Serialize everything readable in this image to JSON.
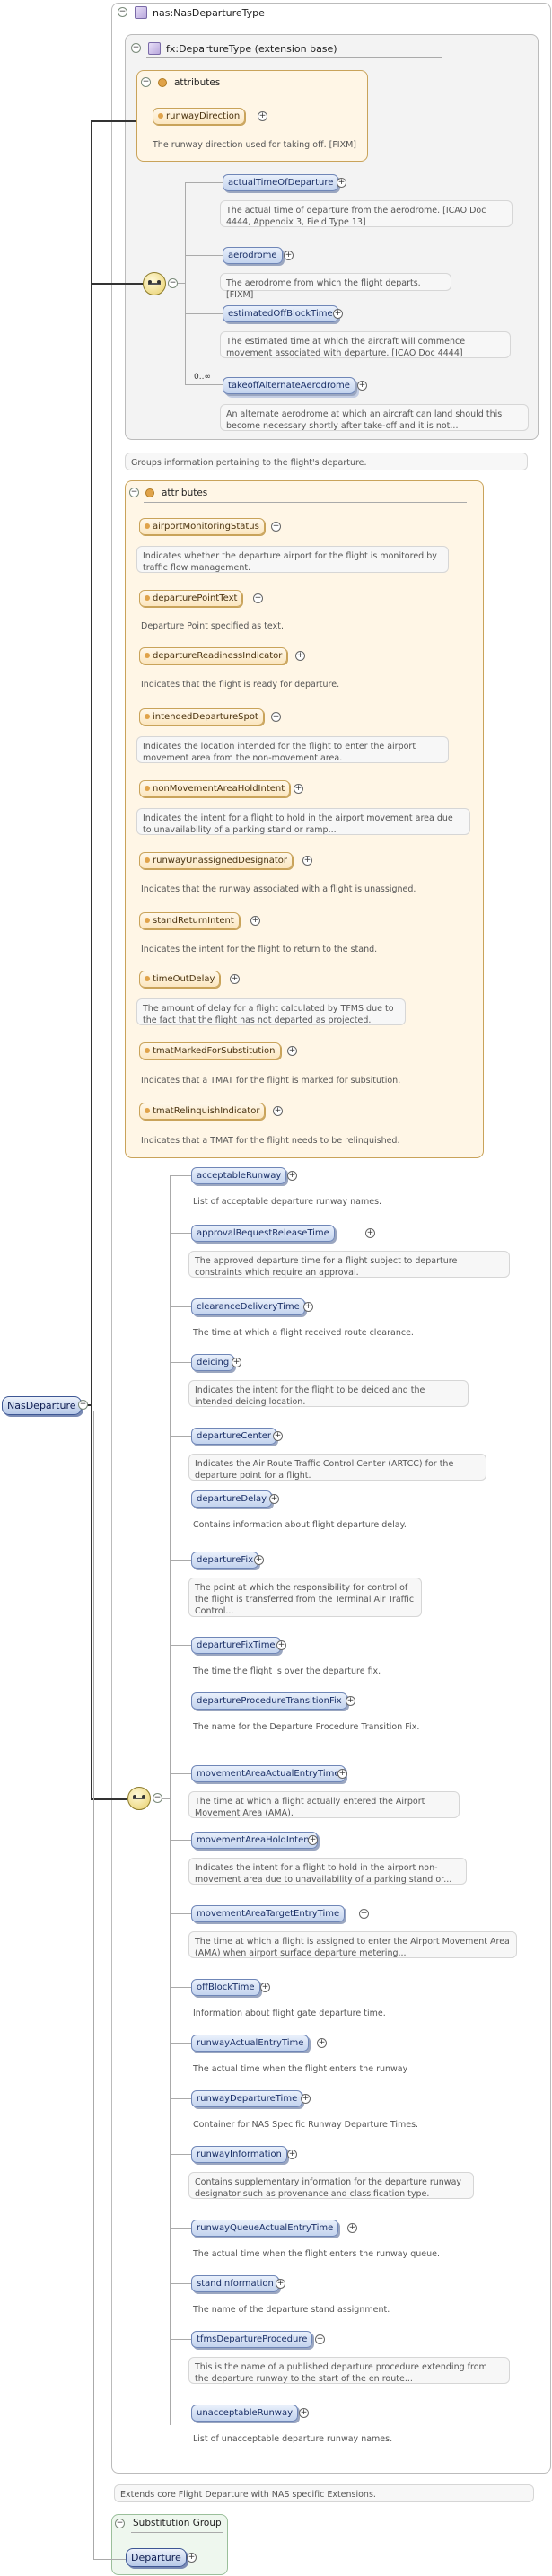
{
  "root": {
    "name": "NasDeparture"
  },
  "type_name": "nas:NasDepartureType",
  "extension_title": "fx:DepartureType (extension base)",
  "ext_attr_header": "attributes",
  "ext_attr": {
    "name": "runwayDirection",
    "desc": "The runway direction used for taking off. [FIXM]"
  },
  "ext_elements": [
    {
      "name": "actualTimeOfDeparture",
      "desc": "The actual time of departure from the aerodrome. [ICAO Doc 4444, Appendix 3, Field Type 13]"
    },
    {
      "name": "aerodrome",
      "desc": "The aerodrome from which the flight departs. [FIXM]"
    },
    {
      "name": "estimatedOffBlockTime",
      "desc": "The estimated time at which the aircraft will commence movement associated with departure. [ICAO Doc 4444]"
    },
    {
      "name": "takeoffAlternateAerodrome",
      "desc": "An alternate aerodrome at which an aircraft can land should this become necessary shortly after take-off and it is not..."
    }
  ],
  "ext_multiplicity": "0..∞",
  "ext_summary": "Groups information pertaining to the flight's departure.",
  "attr_header": "attributes",
  "attributes": [
    {
      "name": "airportMonitoringStatus",
      "desc": "Indicates whether the departure airport for the flight is monitored by traffic flow management."
    },
    {
      "name": "departurePointText",
      "desc": "Departure Point specified as text."
    },
    {
      "name": "departureReadinessIndicator",
      "desc": "Indicates that the flight is ready for departure."
    },
    {
      "name": "intendedDepartureSpot",
      "desc": "Indicates the location intended for the flight to enter the airport movement area from the non-movement area."
    },
    {
      "name": "nonMovementAreaHoldIntent",
      "desc": "Indicates the intent for a flight to hold in the airport movement area due to unavailability of a parking stand or ramp..."
    },
    {
      "name": "runwayUnassignedDesignator",
      "desc": "Indicates that the runway associated with a flight is unassigned."
    },
    {
      "name": "standReturnIntent",
      "desc": "Indicates the intent for the flight to return to the stand."
    },
    {
      "name": "timeOutDelay",
      "desc": "The amount of delay for a flight calculated by TFMS due to the fact that the flight has not departed as projected."
    },
    {
      "name": "tmatMarkedForSubstitution",
      "desc": "Indicates that a TMAT for the flight is marked for subsitution."
    },
    {
      "name": "tmatRelinquishIndicator",
      "desc": "Indicates that a TMAT for the flight needs to be relinquished."
    }
  ],
  "elements": [
    {
      "name": "acceptableRunway",
      "desc": "List of acceptable departure runway names."
    },
    {
      "name": "approvalRequestReleaseTime",
      "desc": "The approved departure time for a flight subject to departure constraints which require an approval."
    },
    {
      "name": "clearanceDeliveryTime",
      "desc": "The time at which a flight received route clearance."
    },
    {
      "name": "deicing",
      "desc": "Indicates the intent for the flight to be deiced and the intended deicing location."
    },
    {
      "name": "departureCenter",
      "desc": "Indicates the Air Route Traffic Control Center (ARTCC) for the departure point for a flight."
    },
    {
      "name": "departureDelay",
      "desc": "Contains information about flight departure delay."
    },
    {
      "name": "departureFix",
      "desc": "The point at which the responsibility for control of the flight is transferred from the Terminal Air Traffic Control..."
    },
    {
      "name": "departureFixTime",
      "desc": "The time the flight is over the departure fix."
    },
    {
      "name": "departureProcedureTransitionFix",
      "desc": "The name for the Departure Procedure Transition Fix."
    },
    {
      "name": "movementAreaActualEntryTime",
      "desc": "The time at which a flight actually entered the Airport Movement Area (AMA)."
    },
    {
      "name": "movementAreaHoldIntent",
      "desc": "Indicates the intent for a flight to hold in the airport non-movement area due to unavailability of a parking stand or..."
    },
    {
      "name": "movementAreaTargetEntryTime",
      "desc": "The time at which a flight is assigned to enter the Airport Movement Area (AMA) when airport surface departure metering..."
    },
    {
      "name": "offBlockTime",
      "desc": "Information about flight gate departure time."
    },
    {
      "name": "runwayActualEntryTime",
      "desc": "The actual time when the flight enters the runway"
    },
    {
      "name": "runwayDepartureTime",
      "desc": "Container for NAS Specific Runway Departure Times."
    },
    {
      "name": "runwayInformation",
      "desc": "Contains supplementary information for the departure runway designator such as provenance and classification type."
    },
    {
      "name": "runwayQueueActualEntryTime",
      "desc": "The actual time when the flight enters the runway queue."
    },
    {
      "name": "standInformation",
      "desc": "The name of the departure stand assignment."
    },
    {
      "name": "tfmsDepartureProcedure",
      "desc": "This is the name of a published departure procedure extending from the departure runway to the start of the en route..."
    },
    {
      "name": "unacceptableRunway",
      "desc": "List of unacceptable departure runway names."
    }
  ],
  "type_summary": "Extends core Flight Departure with NAS specific Extensions.",
  "substitution": {
    "title": "Substitution Group",
    "name": "Departure"
  }
}
